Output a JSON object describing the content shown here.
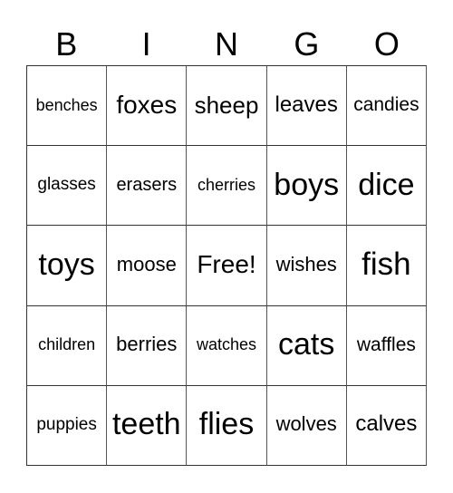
{
  "header": [
    "B",
    "I",
    "N",
    "G",
    "O"
  ],
  "cells": [
    [
      "benches",
      "foxes",
      "sheep",
      "leaves",
      "candies"
    ],
    [
      "glasses",
      "erasers",
      "cherries",
      "boys",
      "dice"
    ],
    [
      "toys",
      "moose",
      "Free!",
      "wishes",
      "fish"
    ],
    [
      "children",
      "berries",
      "watches",
      "cats",
      "waffles"
    ],
    [
      "puppies",
      "teeth",
      "flies",
      "wolves",
      "calves"
    ]
  ]
}
